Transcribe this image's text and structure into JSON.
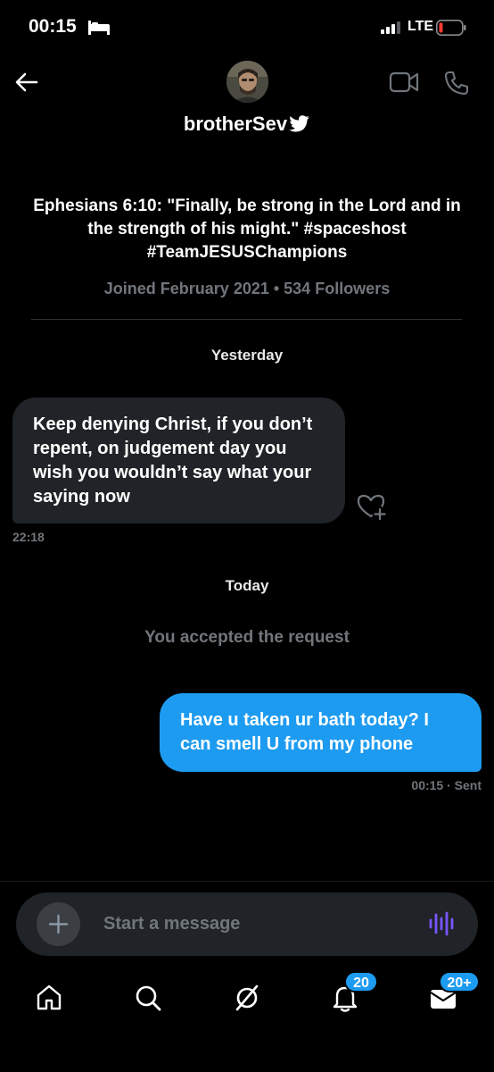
{
  "status_bar": {
    "time": "00:15",
    "network": "LTE",
    "battery_color": "#ff3b30"
  },
  "header": {
    "username": "brotherSev",
    "bio": "Ephesians 6:10: \"Finally, be strong in the Lord and in the strength of his might.\" #spaceshost #TeamJESUSChampions",
    "meta": "Joined February 2021 • 534 Followers",
    "icons": [
      "back-arrow-icon",
      "video-call-icon",
      "phone-call-icon",
      "verified-bird-icon"
    ]
  },
  "conversation": {
    "day_1": "Yesterday",
    "incoming_message": "Keep denying Christ, if you don’t repent, on judgement day you wish you wouldn’t say what your saying now",
    "incoming_time": "22:18",
    "day_2": "Today",
    "system_notice": "You accepted the request",
    "outgoing_message": "Have u taken ur bath today? I can smell U from my phone",
    "outgoing_meta": "00:15 · Sent"
  },
  "composer": {
    "placeholder": "Start a message",
    "accent_color": "#7856ff"
  },
  "tab_bar": {
    "items": [
      "home-icon",
      "search-icon",
      "communities-icon",
      "notifications-icon",
      "messages-icon"
    ],
    "notifications_badge": "20",
    "messages_badge": "20+",
    "badge_color": "#1d9bf0"
  },
  "colors": {
    "background": "#000000",
    "incoming_bubble": "#202327",
    "outgoing_bubble": "#1d9bf0",
    "muted_text": "#71767b"
  }
}
